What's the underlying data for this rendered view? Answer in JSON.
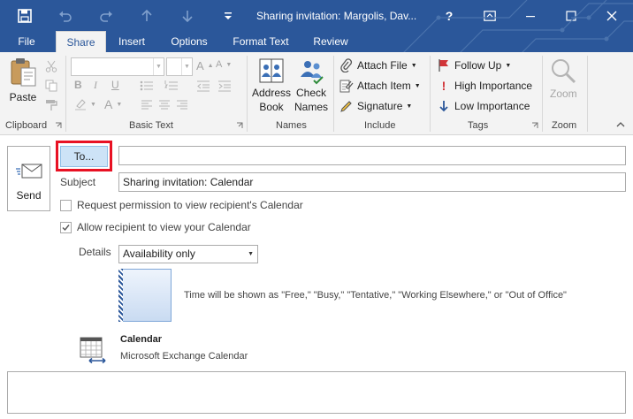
{
  "window": {
    "title": "Sharing invitation: Margolis, Dav...",
    "help": "?"
  },
  "tabs": [
    "File",
    "Share",
    "Insert",
    "Options",
    "Format Text",
    "Review"
  ],
  "ribbon": {
    "clipboard": {
      "paste": "Paste",
      "label": "Clipboard"
    },
    "basic_text": {
      "label": "Basic Text"
    },
    "names": {
      "address_book_1": "Address",
      "address_book_2": "Book",
      "check_names_1": "Check",
      "check_names_2": "Names",
      "label": "Names"
    },
    "include": {
      "attach_file": "Attach File",
      "attach_item": "Attach Item",
      "signature": "Signature",
      "label": "Include"
    },
    "tags": {
      "follow_up": "Follow Up",
      "high_importance": "High Importance",
      "low_importance": "Low Importance",
      "label": "Tags"
    },
    "zoom": {
      "zoom": "Zoom",
      "label": "Zoom"
    }
  },
  "compose": {
    "send": "Send",
    "to_button": "To...",
    "to_value": "",
    "subject_label": "Subject",
    "subject_value": "Sharing invitation: Calendar",
    "request_permission": "Request permission to view recipient's Calendar",
    "allow_view": "Allow recipient to view your Calendar",
    "details_label": "Details",
    "details_value": "Availability only",
    "details_description": "Time will be shown as \"Free,\" \"Busy,\" \"Tentative,\" \"Working Elsewhere,\" or \"Out of Office\"",
    "calendar_name": "Calendar",
    "calendar_source": "Microsoft Exchange Calendar"
  },
  "state": {
    "request_permission_checked": false,
    "allow_view_checked": true
  },
  "colors": {
    "accent": "#2b579a",
    "highlight": "#e81123"
  }
}
